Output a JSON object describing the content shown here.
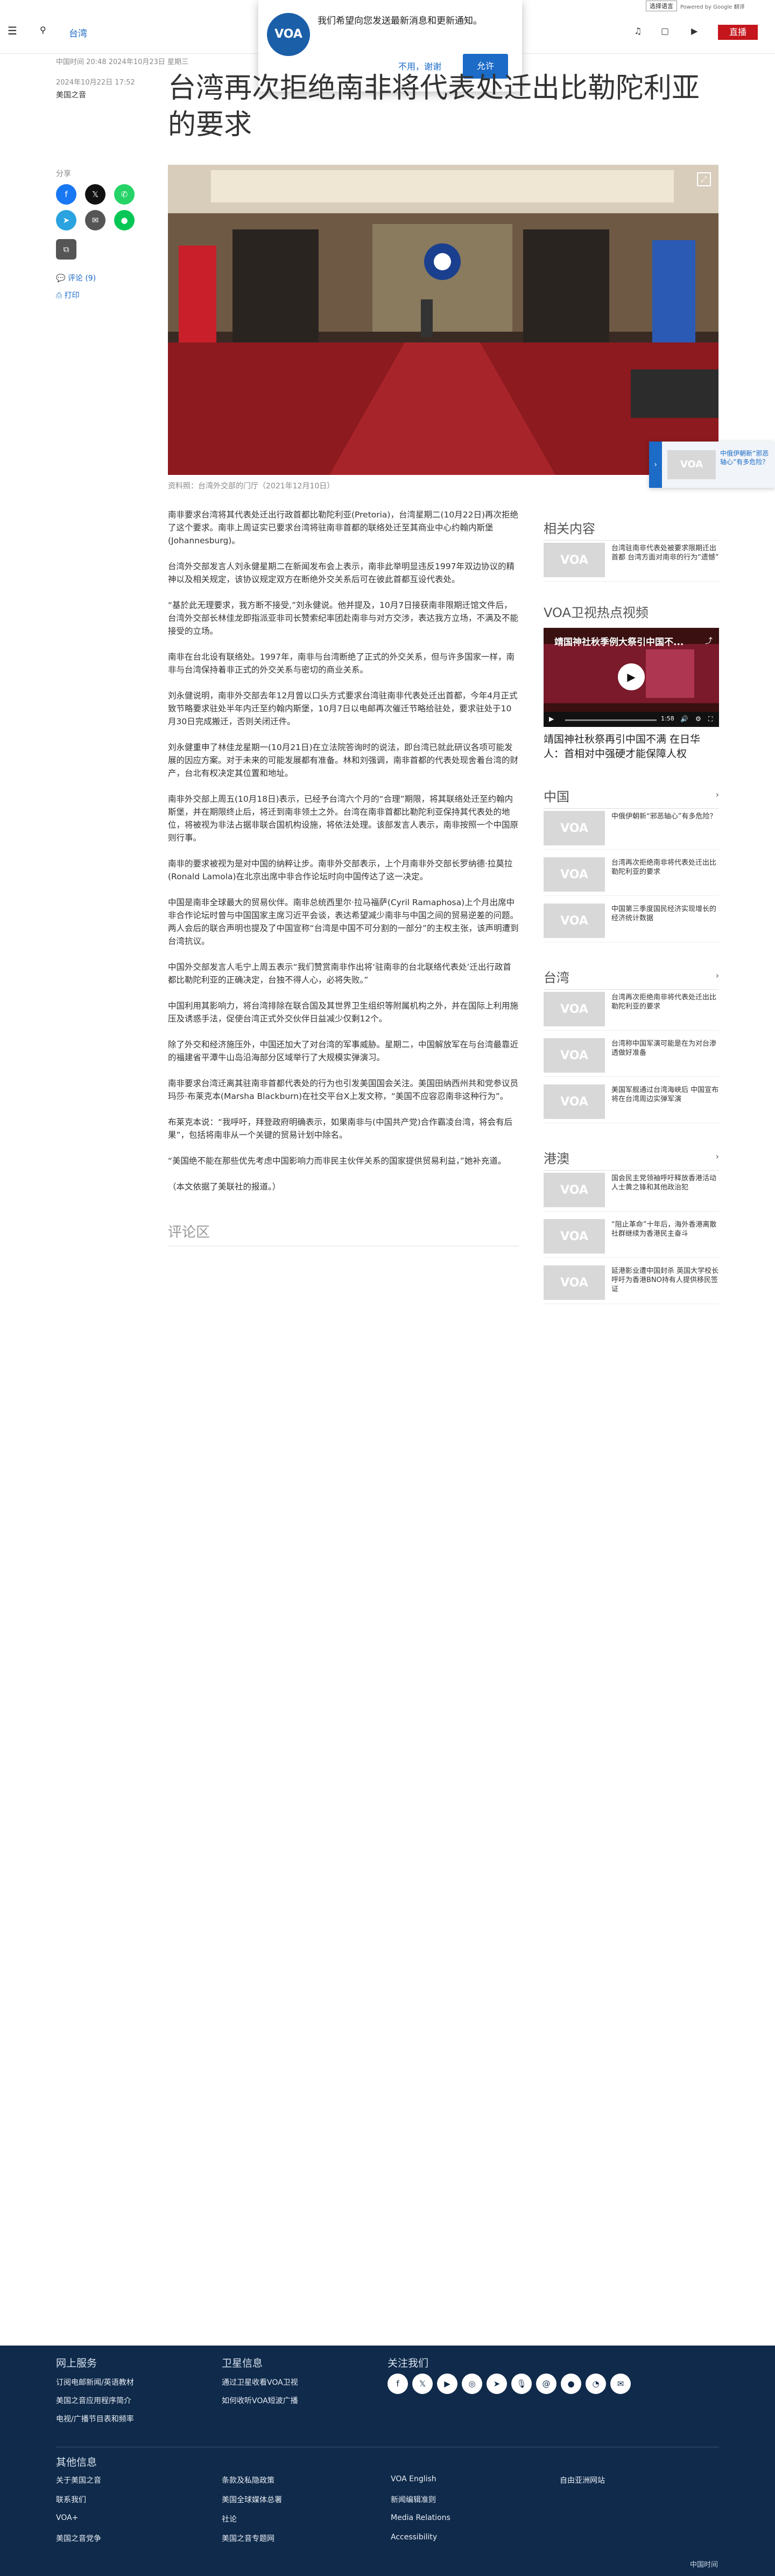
{
  "topbar": {
    "language_select": "选择语言",
    "powered_by": "Powered by Google 翻译"
  },
  "header": {
    "section": "台湾",
    "live_label": "直播"
  },
  "notify": {
    "logo": "VOA",
    "message": "我们希望向您发送最新消息和更新通知。",
    "deny": "不用，谢谢",
    "allow": "允许"
  },
  "article": {
    "published": "中国时间 20:48 2024年10月23日 星期三",
    "date_line": "2024年10月22日 17:52",
    "author": "美国之音",
    "title": "台湾再次拒绝南非将代表处迁出比勒陀利亚的要求",
    "share_label": "分享",
    "comments_link": "评论 (9)",
    "print_link": "打印",
    "caption": "资料照：台湾外交部的门厅（2021年12月10日）",
    "paragraphs": [
      "南非要求台湾将其代表处迁出行政首都比勒陀利亚(Pretoria)，台湾星期二(10月22日)再次拒绝了这个要求。南非上周证实已要求台湾将驻南非首都的联络处迁至其商业中心约翰内斯堡(Johannesburg)。",
      "台湾外交部发言人刘永健星期二在新闻发布会上表示，南非此举明显违反1997年双边协议的精神以及相关规定，该协议规定双方在断绝外交关系后可在彼此首都互设代表处。",
      "“基於此无理要求，我方断不接受,”刘永健说。他并提及，10月7日接获南非限期迁馆文件后，台湾外交部长林佳龙即指派亚非司长赞索纪率团赴南非与对方交涉，表达我方立场，不满及不能接受的立场。",
      "南非在台北设有联络处。1997年，南非与台湾断绝了正式的外交关系，但与许多国家一样，南非与台湾保持着非正式的外交关系与密切的商业关系。",
      "刘永健说明，南非外交部去年12月曾以口头方式要求台湾驻南非代表处迁出首都，今年4月正式致节略要求驻处半年内迁至约翰内斯堡，10月7日以电邮再次催迁节略给驻处，要求驻处于10月30日完成搬迁，否则关闭迁件。",
      "刘永健重申了林佳龙星期一(10月21日)在立法院答询时的说法，即台湾已就此研议各项可能发展的因应方案。对于未来的可能发展都有准备。林和刘强调，南非首都的代表处现舍着台湾的财产，台北有权决定其位置和地址。",
      "南非外交部上周五(10月18日)表示，已经予台湾六个月的“合理”期限，将其联络处迁至约翰内斯堡，并在期限终止后，将迁到南非领土之外。台湾在南非首都比勒陀利亚保持其代表处的地位，将被视为非法占据非联合国机构设施，将依法处理。该部发言人表示，南非按照一个中国原则行事。",
      "南非的要求被视为是对中国的纳粹让步。南非外交部表示，上个月南非外交部长罗纳德·拉莫拉(Ronald Lamola)在北京出席中非合作论坛时向中国传达了这一决定。",
      "中国是南非全球最大的贸易伙伴。南非总统西里尔·拉马福萨(Cyril Ramaphosa)上个月出席中非合作论坛时曾与中国国家主席习近平会谈，表达希望减少南非与中国之间的贸易逆差的问题。两人会后的联合声明也提及了中国宣称“台湾是中国不可分割的一部分”的主权主张，该声明遭到台湾抗议。",
      "中国外交部发言人毛宁上周五表示“我们赞赏南非作出将‘驻南非的台北联络代表处’迁出行政首都比勒陀利亚的正确决定，台独不得人心，必将失败。”",
      "中国利用其影响力，将台湾排除在联合国及其世界卫生组织等附属机构之外，并在国际上利用施压及诱惑手法，促使台湾正式外交伙伴日益减少仅剩12个。",
      "除了外交和经济施压外，中国还加大了对台湾的军事威胁。星期二，中国解放军在与台湾最靠近的福建省平潭牛山岛沿海部分区域举行了大规模实弹演习。",
      "南非要求台湾迁离其驻南非首都代表处的行为也引发美国国会关注。美国田纳西州共和党参议员玛莎·布莱克本(Marsha Blackburn)在社交平台X上发文称，“美国不应容忍南非这种行为”。",
      "布莱克本说：“我呼吁，拜登政府明确表示，如果南非与(中国共产党)合作霸凌台湾，将会有后果”，包括将南非从一个关键的贸易计划中除名。",
      "“美国绝不能在那些优先考虑中国影响力而非民主伙伴关系的国家提供贸易利益，”她补充道。",
      "（本文依据了美联社的报道。）"
    ],
    "comments_heading": "评论区"
  },
  "sidebar": {
    "related_heading": "相关内容",
    "related": [
      {
        "text": "台湾驻南非代表处被要求限期迁出首都 台湾方面对南非的行为“遗憾”"
      }
    ],
    "video_heading": "VOA卫视热点视频",
    "video_overlay_title": "靖国神社秋季例大祭引中国不...",
    "video_time": "1:58",
    "video_caption": "靖国神社秋祭再引中国不满 在日华人：首相对中强硬才能保障人权",
    "china_heading": "中国",
    "china": [
      {
        "text": "中俄伊朝新“邪恶轴心”有多危险？"
      },
      {
        "text": "台湾再次拒绝南非将代表处迁出比勒陀利亚的要求"
      },
      {
        "text": "中国第三季度国民经济实现增长的经济统计数据"
      }
    ],
    "taiwan_heading": "台湾",
    "taiwan": [
      {
        "text": "台湾再次拒绝南非将代表处迁出比勒陀利亚的要求"
      },
      {
        "text": "台湾称中国军演可能是在为对台渗透做好准备"
      },
      {
        "text": "美国军舰通过台湾海峡后 中国宣布将在台湾周边实弹军演"
      }
    ],
    "hk_heading": "港澳",
    "hk": [
      {
        "text": "国会民主党领袖呼吁释放香港活动人士黄之锋和其他政治犯"
      },
      {
        "text": "“阻止革命”十年后，海外香港离散社群继续为香港民主奋斗"
      },
      {
        "text": "延港影业遭中国封杀 英国大学校长呼吁为香港BNO持有人提供移民签证"
      }
    ]
  },
  "floater": {
    "text": "中俄伊朝新“邪恶轴心”有多危险？"
  },
  "footer": {
    "online_heading": "网上服务",
    "online_links": [
      "订阅电邮新闻/英语教材",
      "美国之音应用程序简介",
      "电视/广播节目表和频率"
    ],
    "sat_heading": "卫星信息",
    "sat_links": [
      "通过卫星收看VOA卫视",
      "如何收听VOA短波广播"
    ],
    "follow_heading": "关注我们",
    "other_heading": "其他信息",
    "other_col1": [
      "关于美国之音",
      "联系我们",
      "VOA+",
      "美国之音党争"
    ],
    "other_col2": [
      "条款及私隐政策",
      "美国全球媒体总署",
      "社论",
      "美国之音专题网"
    ],
    "other_col3": [
      "VOA English",
      "新闻编辑准则",
      "Media Relations",
      "Accessibility"
    ],
    "other_col4": [
      "自由亚洲网站"
    ],
    "bottom_right": "中国时间"
  },
  "colors": {
    "accent": "#1b6bc7",
    "live": "#c4161c",
    "footer_bg": "#0f2a4a"
  }
}
